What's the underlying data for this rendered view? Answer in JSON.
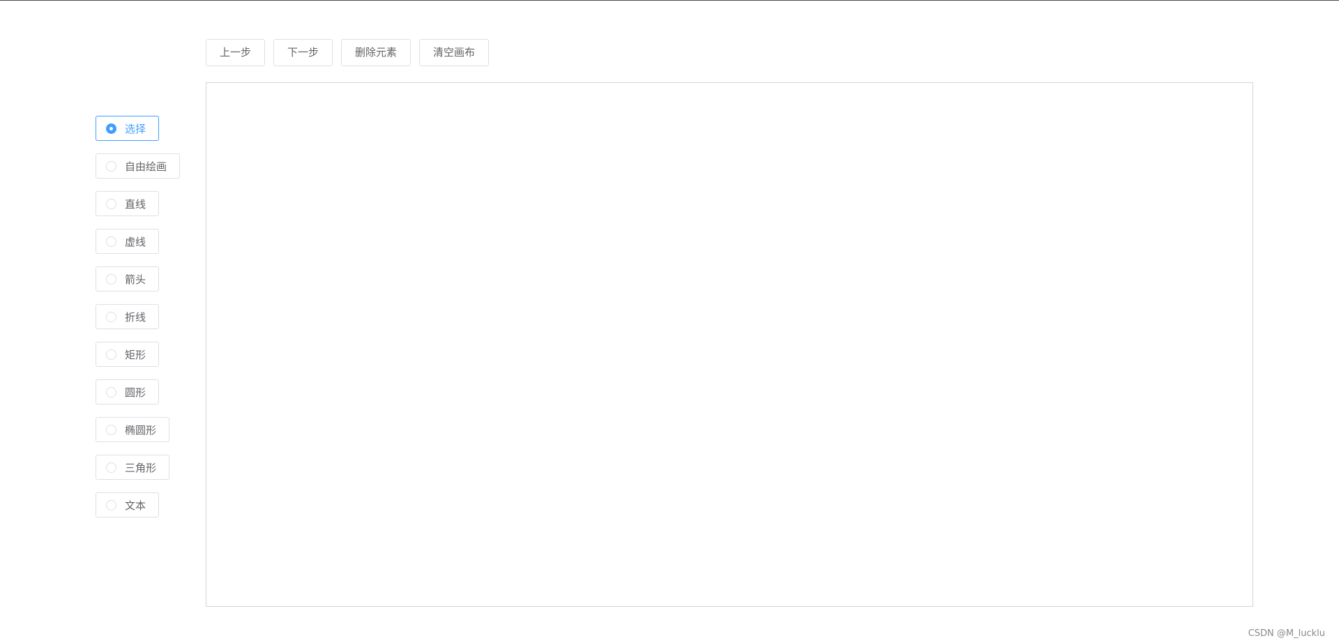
{
  "toolbar": {
    "undo_label": "上一步",
    "redo_label": "下一步",
    "delete_label": "删除元素",
    "clear_label": "清空画布"
  },
  "tools": {
    "selected": "选择",
    "items": [
      {
        "label": "选择"
      },
      {
        "label": "自由绘画"
      },
      {
        "label": "直线"
      },
      {
        "label": "虚线"
      },
      {
        "label": "箭头"
      },
      {
        "label": "折线"
      },
      {
        "label": "矩形"
      },
      {
        "label": "圆形"
      },
      {
        "label": "椭圆形"
      },
      {
        "label": "三角形"
      },
      {
        "label": "文本"
      }
    ]
  },
  "watermark": "CSDN @M_lucklu",
  "colors": {
    "accent": "#409eff",
    "border": "#dcdfe6",
    "text": "#606266"
  }
}
